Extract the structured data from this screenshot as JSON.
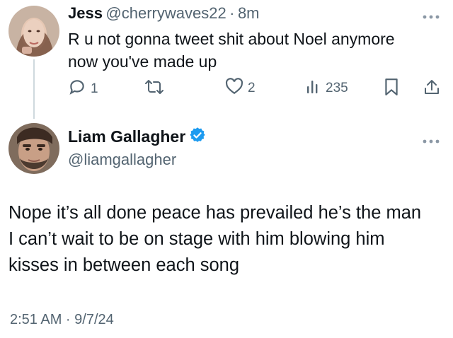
{
  "reply": {
    "name": "Jess",
    "handle": "@cherrywaves22",
    "separator": "·",
    "time": "8m",
    "text_line1": "R u not gonna tweet shit about Noel anymore",
    "text_line2": "now you've made up",
    "actions": {
      "reply_count": "1",
      "like_count": "2",
      "views_count": "235"
    }
  },
  "main": {
    "name": "Liam Gallagher",
    "handle": "@liamgallagher",
    "verified_color": "#1d9bf0",
    "text_line1": "Nope it’s all done peace has prevailed he’s the man",
    "text_line2": "I can’t wait to be on stage with him blowing him",
    "text_line3": "kisses in between each song",
    "timestamp": "2:51 AM · 9/7/24"
  },
  "icons": {
    "reply": "reply-icon",
    "retweet": "retweet-icon",
    "like": "heart-icon",
    "views": "views-icon",
    "bookmark": "bookmark-icon",
    "share": "share-icon",
    "more": "more-icon",
    "verified": "verified-badge-icon"
  }
}
